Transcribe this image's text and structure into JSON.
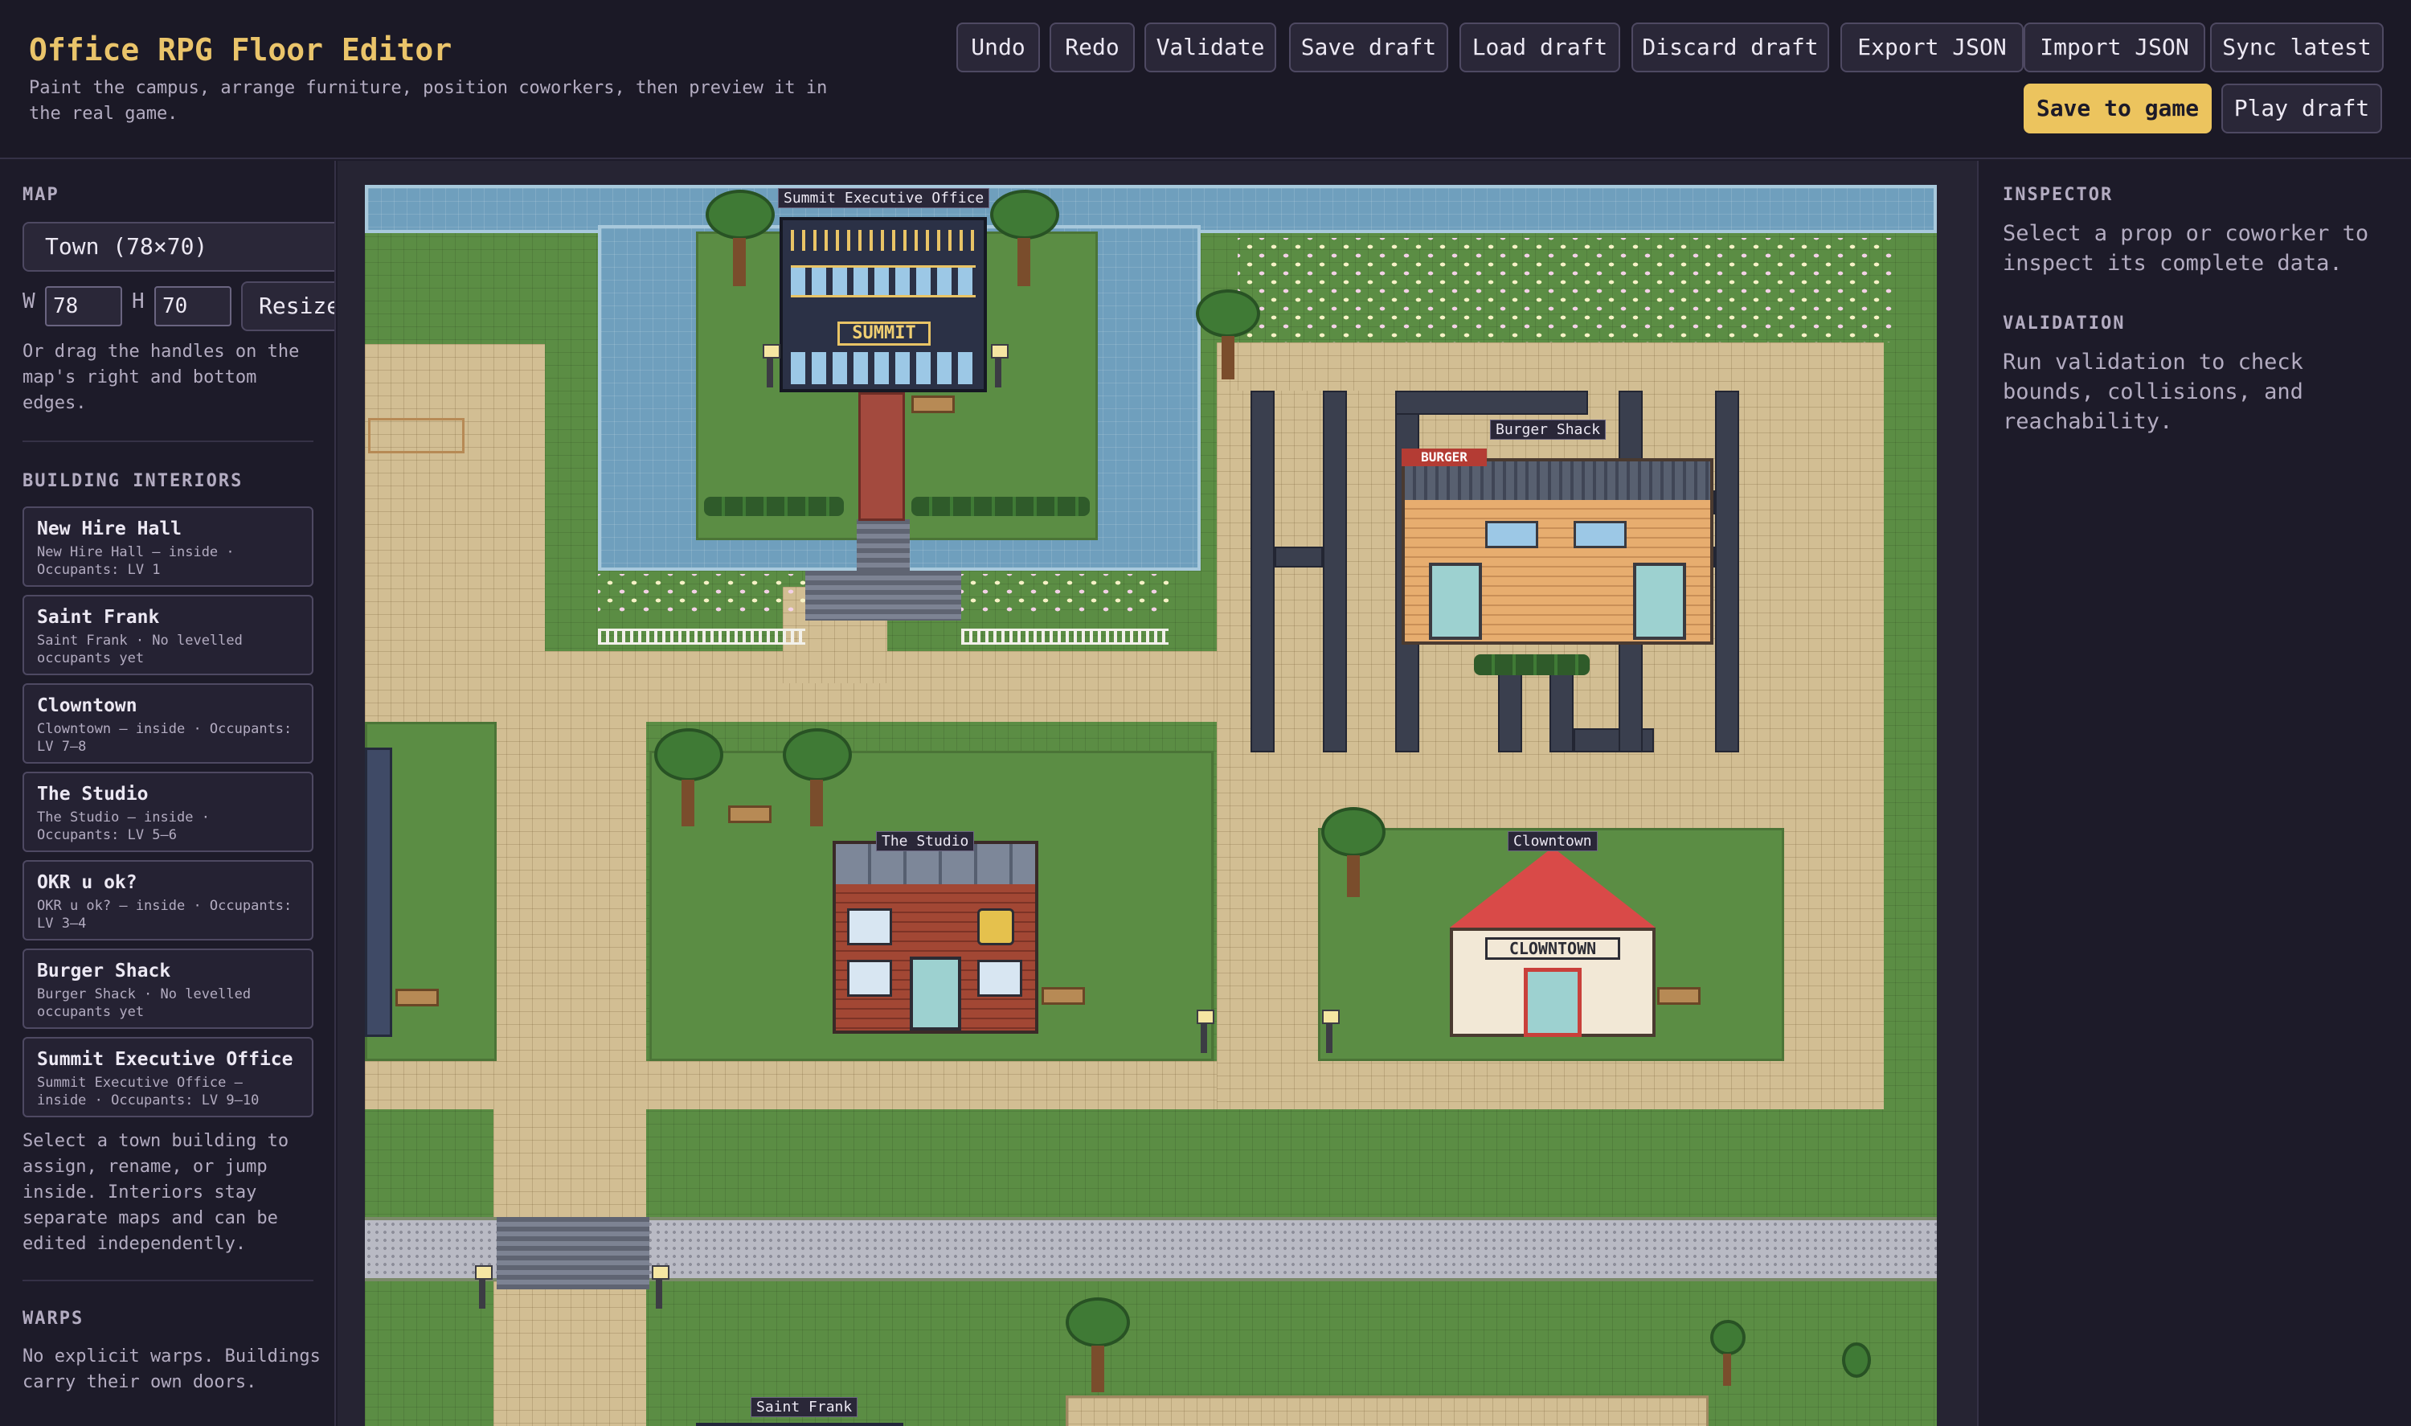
{
  "header": {
    "title": "Office RPG Floor Editor",
    "subtitle": "Paint the campus, arrange furniture, position coworkers, then preview it in the real game.",
    "buttons": {
      "undo": "Undo",
      "redo": "Redo",
      "validate": "Validate",
      "save_draft": "Save draft",
      "load_draft": "Load draft",
      "discard_draft": "Discard draft",
      "export_json": "Export JSON",
      "import_json": "Import JSON",
      "sync_latest": "Sync latest",
      "save_to_game": "Save to game",
      "play_draft": "Play draft"
    }
  },
  "sidebar": {
    "map_label": "MAP",
    "map_select": "Town (78×70)",
    "width_label": "W",
    "width_value": "78",
    "height_label": "H",
    "height_value": "70",
    "resize_label": "Resize",
    "resize_note": "Or drag the handles on the map's right and bottom edges.",
    "interiors_label": "BUILDING INTERIORS",
    "interiors": [
      {
        "title": "New Hire Hall",
        "sub": "New Hire Hall — inside · Occupants: LV 1"
      },
      {
        "title": "Saint Frank",
        "sub": "Saint Frank · No levelled occupants yet"
      },
      {
        "title": "Clowntown",
        "sub": "Clowntown — inside · Occupants: LV 7–8"
      },
      {
        "title": "The Studio",
        "sub": "The Studio — inside · Occupants: LV 5–6"
      },
      {
        "title": "OKR u ok?",
        "sub": "OKR u ok? — inside · Occupants: LV 3–4"
      },
      {
        "title": "Burger Shack",
        "sub": "Burger Shack · No levelled occupants yet"
      },
      {
        "title": "Summit Executive Office",
        "sub": "Summit Executive Office — inside · Occupants: LV 9–10"
      }
    ],
    "interiors_note": "Select a town building to assign, rename, or jump inside. Interiors stay separate maps and can be edited independently.",
    "warps_label": "WARPS",
    "warps_note": "No explicit warps. Buildings carry their own doors."
  },
  "inspector": {
    "label": "INSPECTOR",
    "text": "Select a prop or coworker to inspect its complete data.",
    "validation_label": "VALIDATION",
    "validation_text": "Run validation to check bounds, collisions, and reachability."
  },
  "map": {
    "building_labels": {
      "summit": "Summit Executive Office",
      "burger": "Burger Shack",
      "studio": "The Studio",
      "clowntown": "Clowntown",
      "saint_frank": "Saint Frank"
    },
    "signs": {
      "summit": "SUMMIT",
      "burger": "BURGER",
      "clowntown": "CLOWNTOWN"
    }
  }
}
